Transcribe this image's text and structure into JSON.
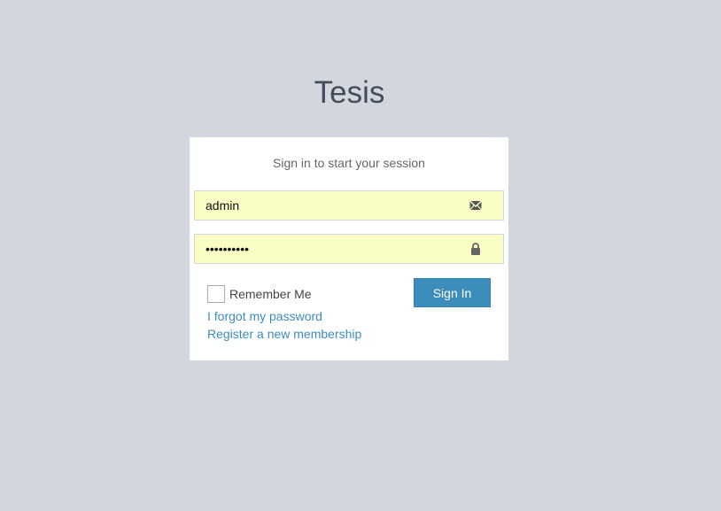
{
  "app": {
    "title": "Tesis"
  },
  "login": {
    "message": "Sign in to start your session",
    "username": {
      "value": "admin",
      "icon": "envelope-icon"
    },
    "password": {
      "value": "••••••••••",
      "icon": "lock-icon"
    },
    "remember_label": "Remember Me",
    "remember_checked": false,
    "signin_label": "Sign In",
    "forgot_link": "I forgot my password",
    "register_link": "Register a new membership"
  },
  "colors": {
    "background": "#d2d6de",
    "accent": "#3c8dbc",
    "autofill": "#fafdc4"
  }
}
